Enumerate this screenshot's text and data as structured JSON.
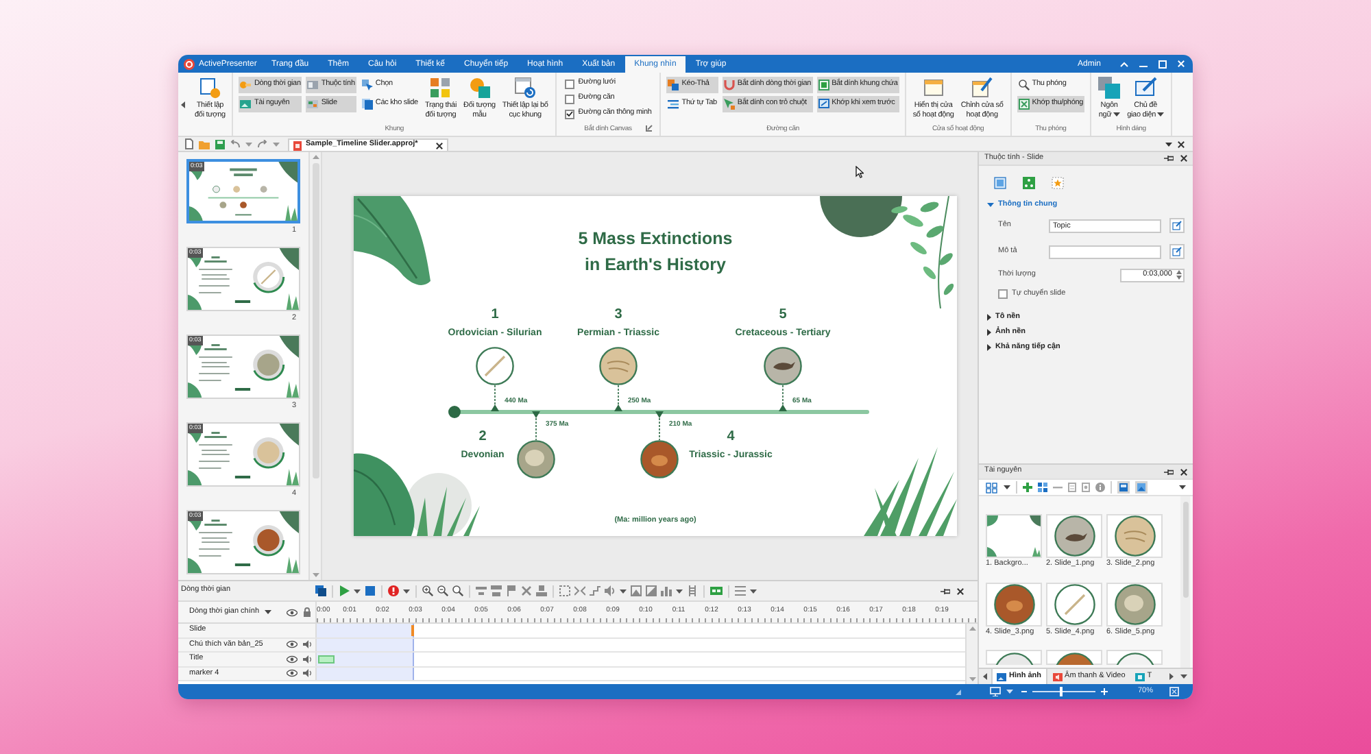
{
  "window": {
    "app_name": "ActivePresenter",
    "user": "Admin"
  },
  "ribbon_tabs": [
    {
      "label": "Trang đầu",
      "selected": false
    },
    {
      "label": "Thêm",
      "selected": false
    },
    {
      "label": "Câu hỏi",
      "selected": false
    },
    {
      "label": "Thiết kế",
      "selected": false
    },
    {
      "label": "Chuyển tiếp",
      "selected": false
    },
    {
      "label": "Hoạt hình",
      "selected": false
    },
    {
      "label": "Xuất bản",
      "selected": false
    },
    {
      "label": "Khung nhìn",
      "selected": true
    },
    {
      "label": "Trợ giúp",
      "selected": false
    }
  ],
  "ribbon_groups": [
    {
      "items": [
        {
          "kind": "large",
          "label": "Thiết lập\nđối tượng"
        }
      ]
    },
    {
      "label": "Khung",
      "items": [
        {
          "kind": "small",
          "label": "Dòng thời gian",
          "on": true
        },
        {
          "kind": "small",
          "label": "Tài nguyên",
          "on": true
        },
        {
          "kind": "small",
          "label": "Thuộc tính",
          "on": true
        },
        {
          "kind": "small",
          "label": "Slide",
          "on": true
        },
        {
          "kind": "small",
          "label": "Chọn",
          "on": false
        },
        {
          "kind": "small",
          "label": "Các kho slide",
          "on": false
        },
        {
          "kind": "large",
          "label": "Trạng thái\nđối tượng"
        },
        {
          "kind": "large",
          "label": "Đối tượng\nmẫu"
        },
        {
          "kind": "large",
          "label": "Thiết lập lại bố\ncục khung"
        }
      ]
    },
    {
      "label": "Bắt dính Canvas",
      "launcher": true,
      "items": [
        {
          "kind": "checkbox",
          "label": "Đường lưới",
          "checked": false
        },
        {
          "kind": "checkbox",
          "label": "Đường căn",
          "checked": false
        },
        {
          "kind": "checkbox",
          "label": "Đường căn thông minh",
          "checked": true
        }
      ]
    },
    {
      "label": "Đường căn",
      "items": [
        {
          "kind": "small",
          "label": "Kéo-Thả",
          "on": true
        },
        {
          "kind": "small",
          "label": "Thứ tự Tab",
          "on": false
        },
        {
          "kind": "small",
          "label": "Bắt dính dòng thời gian",
          "on": true
        },
        {
          "kind": "small",
          "label": "Bắt dính con trỏ chuột",
          "on": true
        },
        {
          "kind": "small",
          "label": "Bắt dính khung chứa",
          "on": true
        },
        {
          "kind": "small",
          "label": "Khớp khi xem trước",
          "on": true
        }
      ]
    },
    {
      "label": "Cửa sổ hoạt động",
      "items": [
        {
          "kind": "large",
          "label": "Hiển thị cửa\nsổ hoạt động"
        },
        {
          "kind": "large",
          "label": "Chỉnh cửa sổ\nhoạt động"
        }
      ]
    },
    {
      "label": "Thu phóng",
      "items": [
        {
          "kind": "small",
          "label": "Thu phóng",
          "on": false
        },
        {
          "kind": "small",
          "label": "Khớp thu/phóng",
          "on": true
        }
      ]
    },
    {
      "label": "Hình dáng",
      "items": [
        {
          "kind": "large",
          "label": "Ngôn\nngữ",
          "menu": true
        },
        {
          "kind": "large",
          "label": "Chủ đề\ngiao diện",
          "menu": true
        }
      ]
    }
  ],
  "document_tab": {
    "title": "Sample_Timeline Slider.approj*"
  },
  "slides": [
    {
      "number": "1",
      "duration": "0:03",
      "selected": true
    },
    {
      "number": "2",
      "duration": "0:03",
      "selected": false
    },
    {
      "number": "3",
      "duration": "0:03",
      "selected": false
    },
    {
      "number": "4",
      "duration": "0:03",
      "selected": false
    },
    {
      "duration": "0:03",
      "selected": false
    }
  ],
  "slide": {
    "title": "5 Mass Extinctions\nin Earth's History",
    "events": [
      {
        "number": "1",
        "name": "Ordovician - Silurian",
        "time": "440 Ma"
      },
      {
        "number": "2",
        "name": "Devonian",
        "time": "375 Ma"
      },
      {
        "number": "3",
        "name": "Permian - Triassic",
        "time": "250 Ma"
      },
      {
        "number": "4",
        "name": "Triassic - Jurassic",
        "time": "210 Ma"
      },
      {
        "number": "5",
        "name": "Cretaceous - Tertiary",
        "time": "65 Ma"
      }
    ],
    "footnote": "(Ma: million years ago)"
  },
  "properties_panel": {
    "title": "Thuộc tính - Slide",
    "sections": [
      {
        "label": "Thông tin chung",
        "expanded": true,
        "fields": [
          {
            "kind": "text",
            "label": "Tên",
            "value": "Topic"
          },
          {
            "kind": "text",
            "label": "Mô tả"
          },
          {
            "kind": "spinner",
            "label": "Thời lượng",
            "value": "0:03,000"
          },
          {
            "kind": "checkbox",
            "label": "Tự chuyển slide",
            "checked": false
          }
        ]
      },
      {
        "label": "Tô nền",
        "expanded": false
      },
      {
        "label": "Ảnh nền",
        "expanded": false
      },
      {
        "label": "Khả năng tiếp cận",
        "expanded": false
      }
    ]
  },
  "resources_panel": {
    "title": "Tài nguyên",
    "items": [
      {
        "kind": "background",
        "label": "1. Backgro..."
      },
      {
        "kind": "photo",
        "label": "2. Slide_1.png"
      },
      {
        "kind": "photo",
        "label": "3. Slide_2.png"
      },
      {
        "kind": "photo",
        "label": "4. Slide_3.png"
      },
      {
        "kind": "photo",
        "label": "5. Slide_4.png"
      },
      {
        "kind": "photo",
        "label": "6. Slide_5.png"
      },
      {
        "kind": "photo"
      },
      {
        "kind": "photo"
      },
      {
        "kind": "photo"
      }
    ],
    "tabs": [
      {
        "label": "Hình ảnh",
        "selected": true
      },
      {
        "label": "Âm thanh & Video",
        "selected": false
      },
      {
        "label": "T",
        "selected": false
      }
    ]
  },
  "timeline": {
    "title": "Dòng thời gian",
    "track_selector": "Dòng thời gian chính",
    "ruler": [
      "0:00",
      "0:01",
      "0:02",
      "0:03",
      "0:04",
      "0:05",
      "0:06",
      "0:07",
      "0:08",
      "0:09",
      "0:10",
      "0:11",
      "0:12",
      "0:13",
      "0:14",
      "0:15",
      "0:16",
      "0:17",
      "0:18",
      "0:19"
    ],
    "rows": [
      {
        "kind": "slide",
        "label": "Slide"
      },
      {
        "kind": "object",
        "label": "Chú thích văn bản_25"
      },
      {
        "kind": "object",
        "label": "Title",
        "effect": true
      },
      {
        "kind": "object",
        "label": "marker 4"
      }
    ]
  },
  "status_bar": {
    "zoom": "70%",
    "zoom_slider": {
      "level": 0.45
    }
  }
}
